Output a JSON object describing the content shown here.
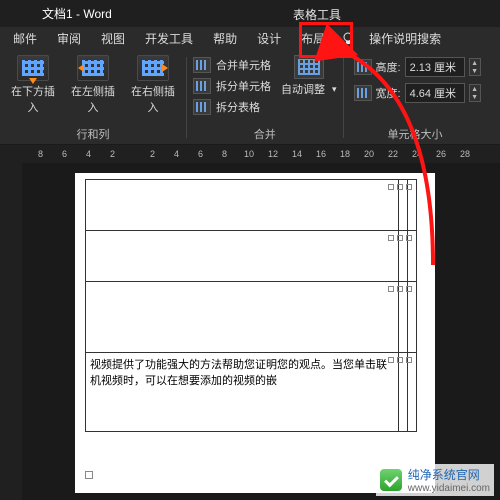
{
  "title": "文档1 - Word",
  "table_tools": "表格工具",
  "tabs": {
    "mail": "邮件",
    "review": "审阅",
    "view": "视图",
    "dev": "开发工具",
    "help": "帮助",
    "design": "设计",
    "layout": "布局",
    "tell_me": "操作说明搜索"
  },
  "ribbon": {
    "rows_cols": {
      "insert_below": "在下方插入",
      "insert_left": "在左侧插入",
      "insert_right": "在右侧插入",
      "group": "行和列"
    },
    "merge": {
      "merge_cells": "合并单元格",
      "split_cells": "拆分单元格",
      "split_table": "拆分表格",
      "group": "合并"
    },
    "auto": {
      "auto_adjust": "自动调整"
    },
    "size": {
      "height_label": "高度:",
      "height_val": "2.13 厘米",
      "width_label": "宽度:",
      "width_val": "4.64 厘米",
      "group": "单元格大小"
    }
  },
  "ruler": {
    "n8": "8",
    "n6": "6",
    "n4": "4",
    "n2a": "2",
    "n2b": "2",
    "p4": "4",
    "p6": "6",
    "p8": "8",
    "p10": "10",
    "p12": "12",
    "p14": "14",
    "p16": "16",
    "p18": "18",
    "p20": "20",
    "p22": "22",
    "p24": "24",
    "p26": "26",
    "p28": "28"
  },
  "content": {
    "cell_text": "视频提供了功能强大的方法帮助您证明您的观点。当您单击联机视频时，可以在想要添加的视频的嵌"
  },
  "watermark": {
    "brand": "纯净系统官网",
    "url": "www.yidaimei.com"
  }
}
